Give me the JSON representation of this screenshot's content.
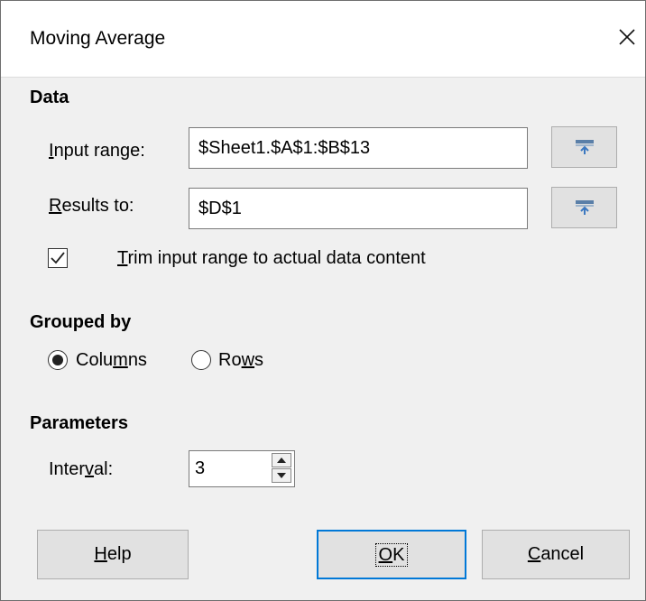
{
  "window": {
    "title": "Moving Average",
    "close_icon": "close-icon"
  },
  "data_section": {
    "heading": "Data",
    "input_range": {
      "label_pre": "",
      "label_key": "I",
      "label_post": "nput range:",
      "value": "$Sheet1.$A$1:$B$13",
      "shrink_icon": "shrink-icon"
    },
    "results_to": {
      "label_key": "R",
      "label_post": "esults to:",
      "value": "$D$1",
      "shrink_icon": "shrink-icon"
    },
    "trim": {
      "checked": true,
      "label_key": "T",
      "label_post": "rim input range to actual data content"
    }
  },
  "grouped_by": {
    "heading": "Grouped by",
    "columns": {
      "label_pre": "Colu",
      "label_key": "m",
      "label_post": "ns",
      "selected": true
    },
    "rows": {
      "label_pre": "Ro",
      "label_key": "w",
      "label_post": "s",
      "selected": false
    }
  },
  "parameters": {
    "heading": "Parameters",
    "interval": {
      "label_pre": "Inter",
      "label_key": "v",
      "label_post": "al:",
      "value": "3"
    }
  },
  "buttons": {
    "help": {
      "label_key": "H",
      "label_post": "elp"
    },
    "ok": {
      "label_key": "O",
      "label_post": "K"
    },
    "cancel": {
      "label_key": "C",
      "label_post": "ancel"
    }
  },
  "colors": {
    "accent": "#0078d7",
    "background": "#f0f0f0",
    "titlebar": "#ffffff"
  }
}
